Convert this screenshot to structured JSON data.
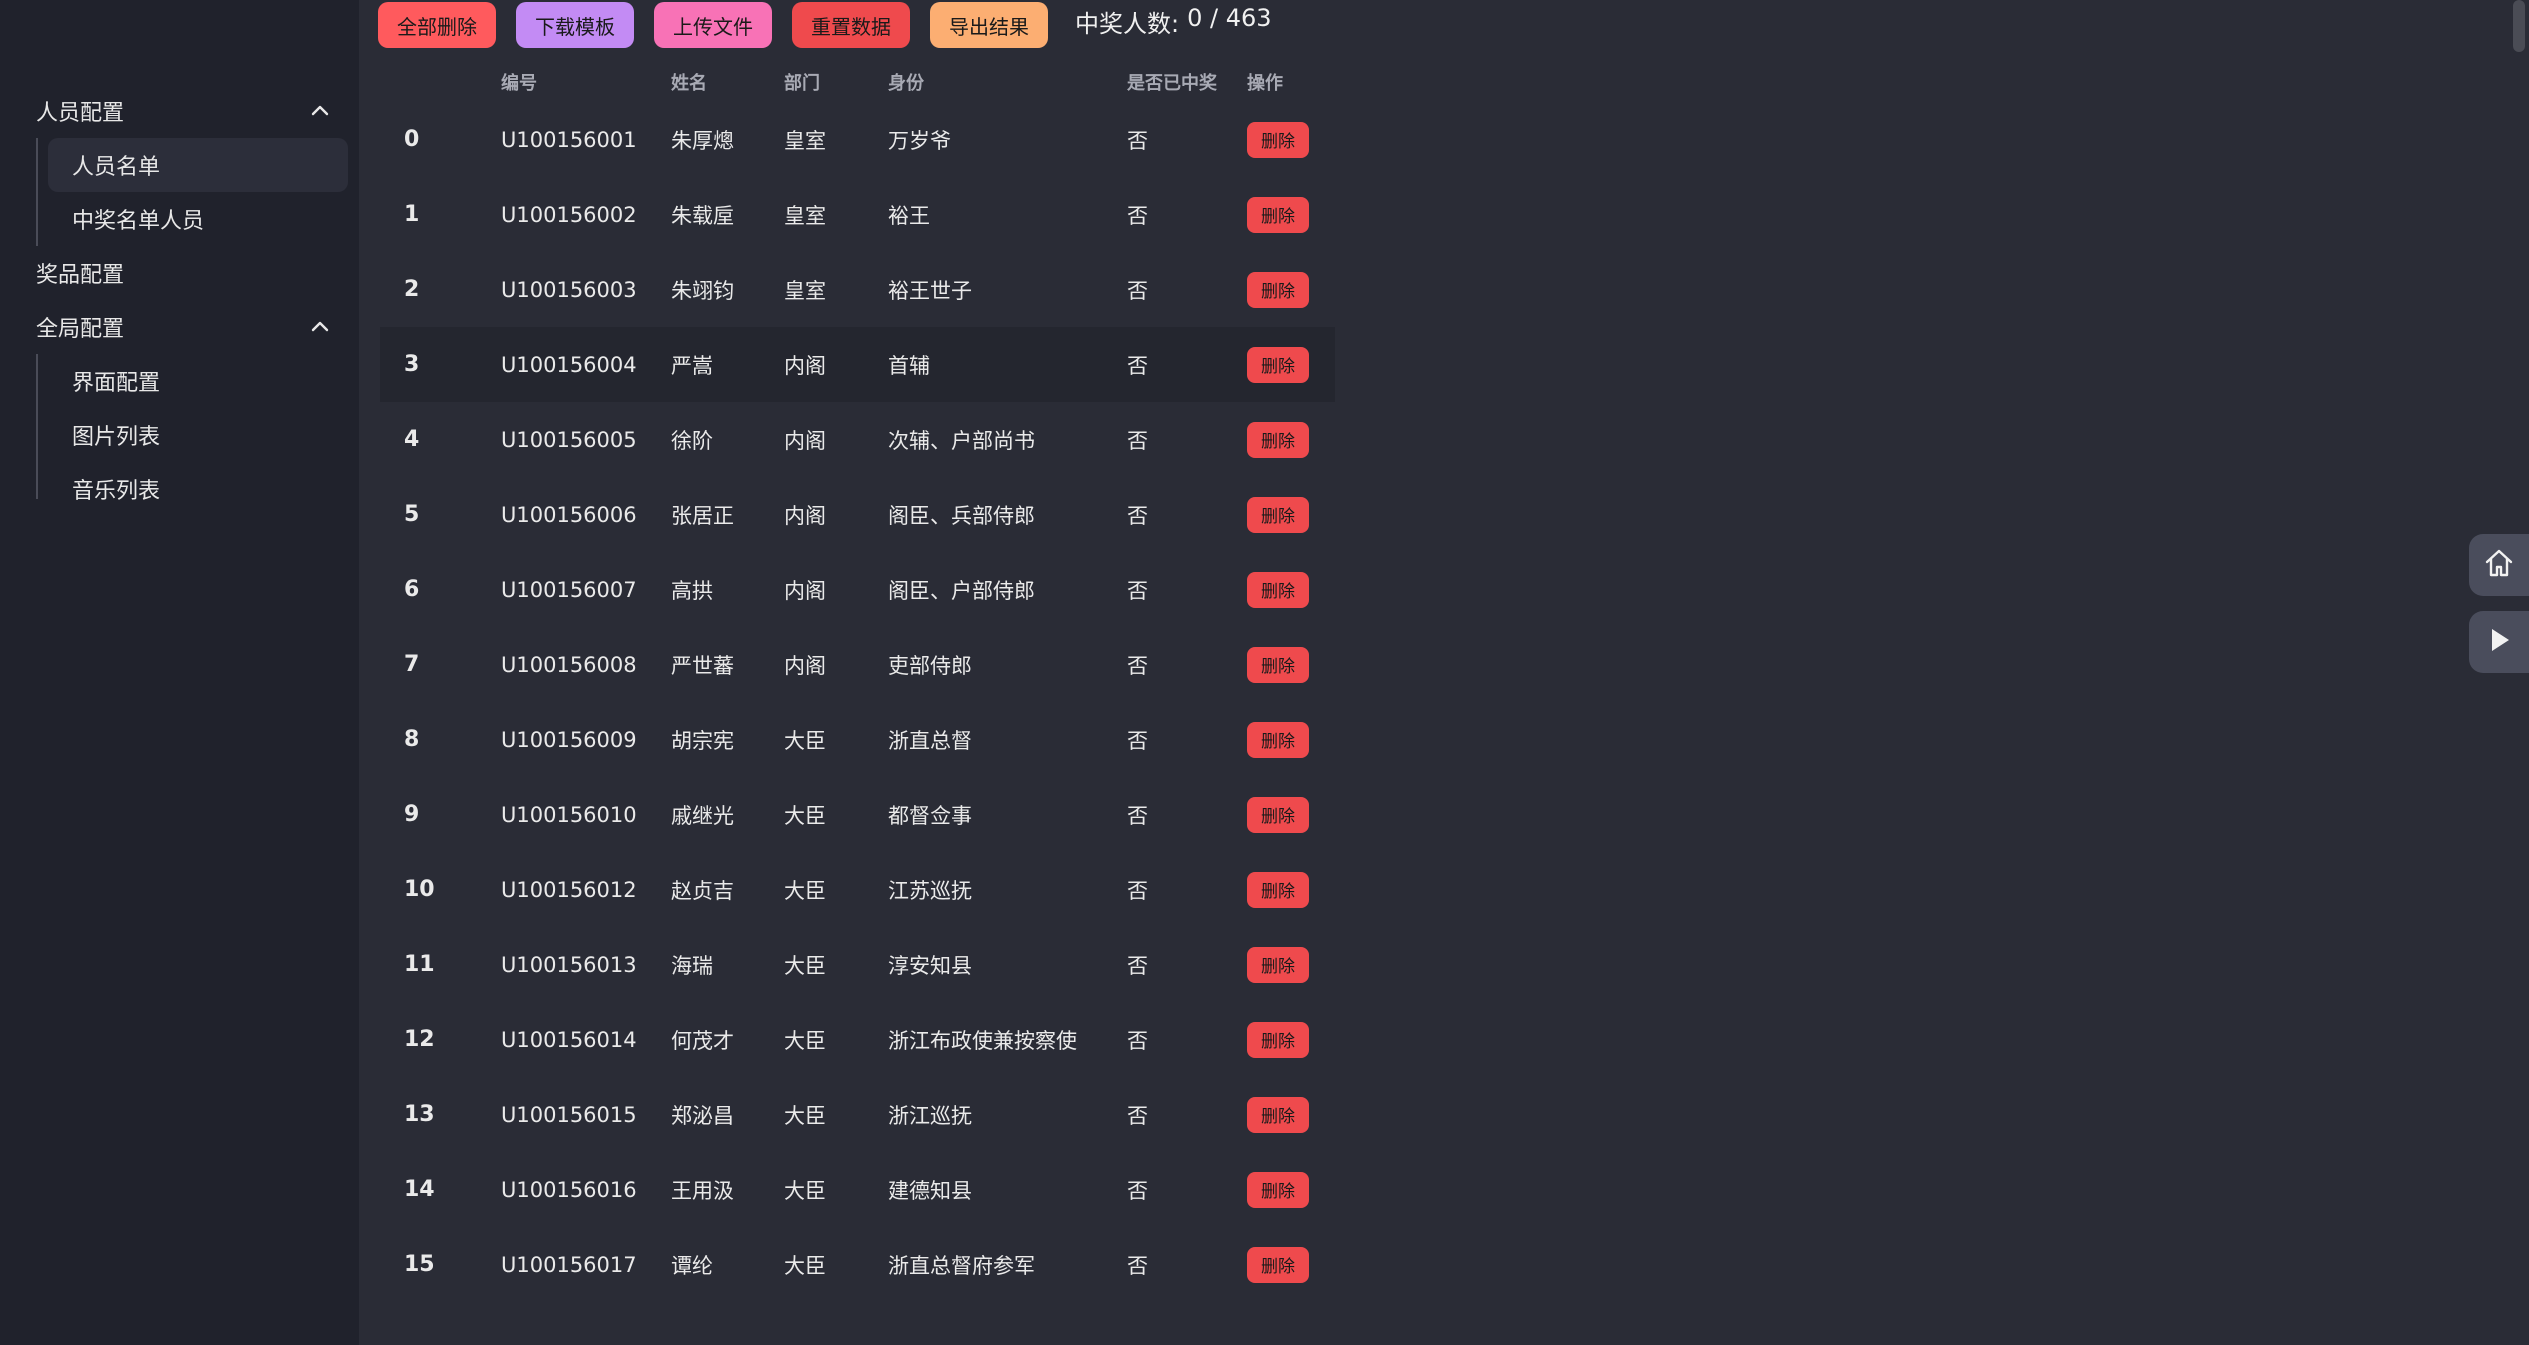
{
  "sidebar": {
    "groups": [
      {
        "label": "人员配置",
        "items": [
          "人员名单",
          "中奖名单人员"
        ]
      },
      {
        "label": "奖品配置"
      },
      {
        "label": "全局配置",
        "items": [
          "界面配置",
          "图片列表",
          "音乐列表"
        ]
      }
    ],
    "active_item": "人员名单"
  },
  "toolbar": {
    "delete_all": "全部删除",
    "download_template": "下载模板",
    "upload_file": "上传文件",
    "reset_data": "重置数据",
    "export_results": "导出结果",
    "winner_count_label": "中奖人数:",
    "winner_count_value": "0 / 463",
    "colors": {
      "delete_all": "#ff5a5d",
      "download_template": "#c38bf4",
      "upload_file": "#f872b6",
      "reset_data": "#ef4a4d",
      "export_results": "#fcae72"
    }
  },
  "table": {
    "headers": [
      "编号",
      "姓名",
      "部门",
      "身份",
      "是否已中奖",
      "操作"
    ],
    "delete_label": "删除",
    "rows": [
      {
        "idx": "0",
        "id": "U100156001",
        "name": "朱厚熜",
        "dept": "皇室",
        "role": "万岁爷",
        "won": "否"
      },
      {
        "idx": "1",
        "id": "U100156002",
        "name": "朱载垕",
        "dept": "皇室",
        "role": "裕王",
        "won": "否"
      },
      {
        "idx": "2",
        "id": "U100156003",
        "name": "朱翊钧",
        "dept": "皇室",
        "role": "裕王世子",
        "won": "否"
      },
      {
        "idx": "3",
        "id": "U100156004",
        "name": "严嵩",
        "dept": "内阁",
        "role": "首辅",
        "won": "否"
      },
      {
        "idx": "4",
        "id": "U100156005",
        "name": "徐阶",
        "dept": "内阁",
        "role": "次辅、户部尚书",
        "won": "否"
      },
      {
        "idx": "5",
        "id": "U100156006",
        "name": "张居正",
        "dept": "内阁",
        "role": "阁臣、兵部侍郎",
        "won": "否"
      },
      {
        "idx": "6",
        "id": "U100156007",
        "name": "高拱",
        "dept": "内阁",
        "role": "阁臣、户部侍郎",
        "won": "否"
      },
      {
        "idx": "7",
        "id": "U100156008",
        "name": "严世蕃",
        "dept": "内阁",
        "role": "吏部侍郎",
        "won": "否"
      },
      {
        "idx": "8",
        "id": "U100156009",
        "name": "胡宗宪",
        "dept": "大臣",
        "role": "浙直总督",
        "won": "否"
      },
      {
        "idx": "9",
        "id": "U100156010",
        "name": "戚继光",
        "dept": "大臣",
        "role": "都督佥事",
        "won": "否"
      },
      {
        "idx": "10",
        "id": "U100156012",
        "name": "赵贞吉",
        "dept": "大臣",
        "role": "江苏巡抚",
        "won": "否"
      },
      {
        "idx": "11",
        "id": "U100156013",
        "name": "海瑞",
        "dept": "大臣",
        "role": "淳安知县",
        "won": "否"
      },
      {
        "idx": "12",
        "id": "U100156014",
        "name": "何茂才",
        "dept": "大臣",
        "role": "浙江布政使兼按察使",
        "won": "否"
      },
      {
        "idx": "13",
        "id": "U100156015",
        "name": "郑泌昌",
        "dept": "大臣",
        "role": "浙江巡抚",
        "won": "否"
      },
      {
        "idx": "14",
        "id": "U100156016",
        "name": "王用汲",
        "dept": "大臣",
        "role": "建德知县",
        "won": "否"
      },
      {
        "idx": "15",
        "id": "U100156017",
        "name": "谭纶",
        "dept": "大臣",
        "role": "浙直总督府参军",
        "won": "否"
      }
    ]
  },
  "icons": {
    "home": "home-icon",
    "play": "play-icon",
    "chevron": "chevron-up-icon"
  }
}
